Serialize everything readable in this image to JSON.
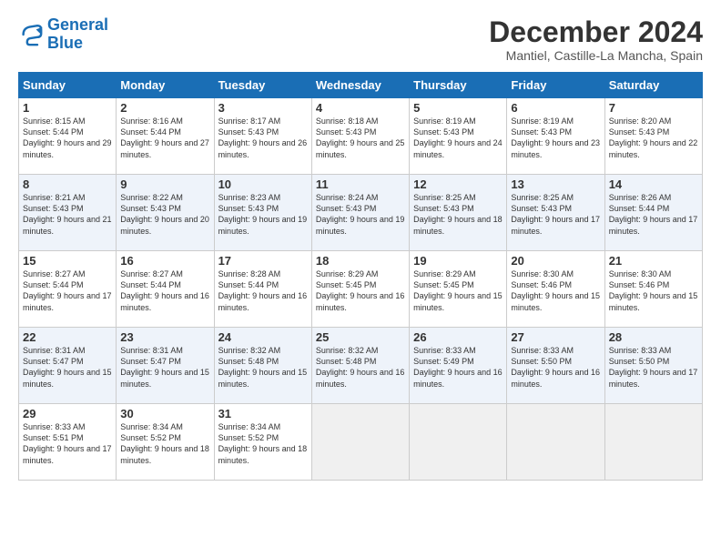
{
  "logo": {
    "line1": "General",
    "line2": "Blue"
  },
  "title": "December 2024",
  "location": "Mantiel, Castille-La Mancha, Spain",
  "days_of_week": [
    "Sunday",
    "Monday",
    "Tuesday",
    "Wednesday",
    "Thursday",
    "Friday",
    "Saturday"
  ],
  "weeks": [
    [
      {
        "num": "1",
        "sunrise": "8:15 AM",
        "sunset": "5:44 PM",
        "daylight": "9 hours and 29 minutes."
      },
      {
        "num": "2",
        "sunrise": "8:16 AM",
        "sunset": "5:44 PM",
        "daylight": "9 hours and 27 minutes."
      },
      {
        "num": "3",
        "sunrise": "8:17 AM",
        "sunset": "5:43 PM",
        "daylight": "9 hours and 26 minutes."
      },
      {
        "num": "4",
        "sunrise": "8:18 AM",
        "sunset": "5:43 PM",
        "daylight": "9 hours and 25 minutes."
      },
      {
        "num": "5",
        "sunrise": "8:19 AM",
        "sunset": "5:43 PM",
        "daylight": "9 hours and 24 minutes."
      },
      {
        "num": "6",
        "sunrise": "8:19 AM",
        "sunset": "5:43 PM",
        "daylight": "9 hours and 23 minutes."
      },
      {
        "num": "7",
        "sunrise": "8:20 AM",
        "sunset": "5:43 PM",
        "daylight": "9 hours and 22 minutes."
      }
    ],
    [
      {
        "num": "8",
        "sunrise": "8:21 AM",
        "sunset": "5:43 PM",
        "daylight": "9 hours and 21 minutes."
      },
      {
        "num": "9",
        "sunrise": "8:22 AM",
        "sunset": "5:43 PM",
        "daylight": "9 hours and 20 minutes."
      },
      {
        "num": "10",
        "sunrise": "8:23 AM",
        "sunset": "5:43 PM",
        "daylight": "9 hours and 19 minutes."
      },
      {
        "num": "11",
        "sunrise": "8:24 AM",
        "sunset": "5:43 PM",
        "daylight": "9 hours and 19 minutes."
      },
      {
        "num": "12",
        "sunrise": "8:25 AM",
        "sunset": "5:43 PM",
        "daylight": "9 hours and 18 minutes."
      },
      {
        "num": "13",
        "sunrise": "8:25 AM",
        "sunset": "5:43 PM",
        "daylight": "9 hours and 17 minutes."
      },
      {
        "num": "14",
        "sunrise": "8:26 AM",
        "sunset": "5:44 PM",
        "daylight": "9 hours and 17 minutes."
      }
    ],
    [
      {
        "num": "15",
        "sunrise": "8:27 AM",
        "sunset": "5:44 PM",
        "daylight": "9 hours and 17 minutes."
      },
      {
        "num": "16",
        "sunrise": "8:27 AM",
        "sunset": "5:44 PM",
        "daylight": "9 hours and 16 minutes."
      },
      {
        "num": "17",
        "sunrise": "8:28 AM",
        "sunset": "5:44 PM",
        "daylight": "9 hours and 16 minutes."
      },
      {
        "num": "18",
        "sunrise": "8:29 AM",
        "sunset": "5:45 PM",
        "daylight": "9 hours and 16 minutes."
      },
      {
        "num": "19",
        "sunrise": "8:29 AM",
        "sunset": "5:45 PM",
        "daylight": "9 hours and 15 minutes."
      },
      {
        "num": "20",
        "sunrise": "8:30 AM",
        "sunset": "5:46 PM",
        "daylight": "9 hours and 15 minutes."
      },
      {
        "num": "21",
        "sunrise": "8:30 AM",
        "sunset": "5:46 PM",
        "daylight": "9 hours and 15 minutes."
      }
    ],
    [
      {
        "num": "22",
        "sunrise": "8:31 AM",
        "sunset": "5:47 PM",
        "daylight": "9 hours and 15 minutes."
      },
      {
        "num": "23",
        "sunrise": "8:31 AM",
        "sunset": "5:47 PM",
        "daylight": "9 hours and 15 minutes."
      },
      {
        "num": "24",
        "sunrise": "8:32 AM",
        "sunset": "5:48 PM",
        "daylight": "9 hours and 15 minutes."
      },
      {
        "num": "25",
        "sunrise": "8:32 AM",
        "sunset": "5:48 PM",
        "daylight": "9 hours and 16 minutes."
      },
      {
        "num": "26",
        "sunrise": "8:33 AM",
        "sunset": "5:49 PM",
        "daylight": "9 hours and 16 minutes."
      },
      {
        "num": "27",
        "sunrise": "8:33 AM",
        "sunset": "5:50 PM",
        "daylight": "9 hours and 16 minutes."
      },
      {
        "num": "28",
        "sunrise": "8:33 AM",
        "sunset": "5:50 PM",
        "daylight": "9 hours and 17 minutes."
      }
    ],
    [
      {
        "num": "29",
        "sunrise": "8:33 AM",
        "sunset": "5:51 PM",
        "daylight": "9 hours and 17 minutes."
      },
      {
        "num": "30",
        "sunrise": "8:34 AM",
        "sunset": "5:52 PM",
        "daylight": "9 hours and 18 minutes."
      },
      {
        "num": "31",
        "sunrise": "8:34 AM",
        "sunset": "5:52 PM",
        "daylight": "9 hours and 18 minutes."
      },
      null,
      null,
      null,
      null
    ]
  ]
}
